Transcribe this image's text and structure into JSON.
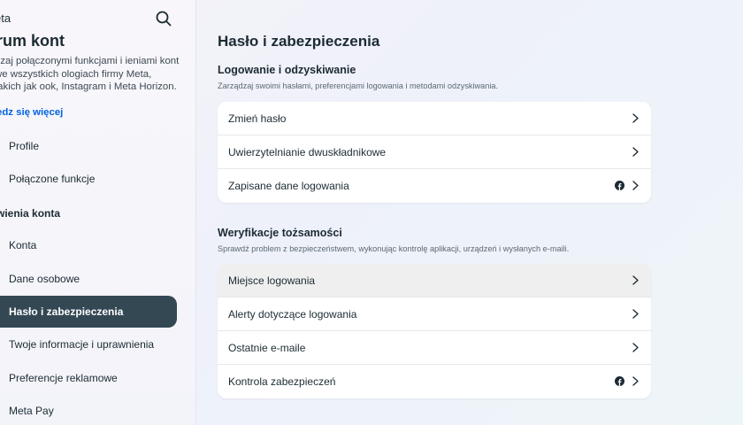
{
  "sidebar": {
    "brand": "eta",
    "title": "trum kont",
    "description": "dzaj połączonymi funkcjami i ieniami kont we wszystkich ologiach firmy Meta, takich jak ook, Instagram i Meta Horizon.",
    "link": "edz się więcej",
    "items_top": [
      "Profile",
      "Połączone funkcje"
    ],
    "section_header": "wienia konta",
    "items": [
      "Konta",
      "Dane osobowe",
      "Hasło i zabezpieczenia",
      "Twoje informacje i uprawnienia",
      "Preferencje reklamowe",
      "Meta Pay"
    ],
    "active_item": "Hasło i zabezpieczenia"
  },
  "main": {
    "title": "Hasło i zabezpieczenia",
    "sections": [
      {
        "title": "Logowanie i odzyskiwanie",
        "description": "Zarządzaj swoimi hasłami, preferencjami logowania i metodami odzyskiwania.",
        "rows": [
          {
            "label": "Zmień hasło",
            "facebook_icon": false
          },
          {
            "label": "Uwierzytelnianie dwuskładnikowe",
            "facebook_icon": false
          },
          {
            "label": "Zapisane dane logowania",
            "facebook_icon": true
          }
        ]
      },
      {
        "title": "Weryfikacje tożsamości",
        "description": "Sprawdź problem z bezpieczeństwem, wykonując kontrolę aplikacji, urządzeń i wysłanych e-maili.",
        "rows": [
          {
            "label": "Miejsce logowania",
            "facebook_icon": false
          },
          {
            "label": "Alerty dotyczące logowania",
            "facebook_icon": false
          },
          {
            "label": "Ostatnie e-maile",
            "facebook_icon": false
          },
          {
            "label": "Kontrola zabezpieczeń",
            "facebook_icon": true
          }
        ]
      }
    ]
  },
  "icons": {
    "search": "search-icon",
    "chevron": "chevron-right-icon",
    "facebook": "facebook-icon"
  },
  "colors": {
    "active_nav": "#344854",
    "link": "#0064e0",
    "text": "#1c2b33"
  }
}
